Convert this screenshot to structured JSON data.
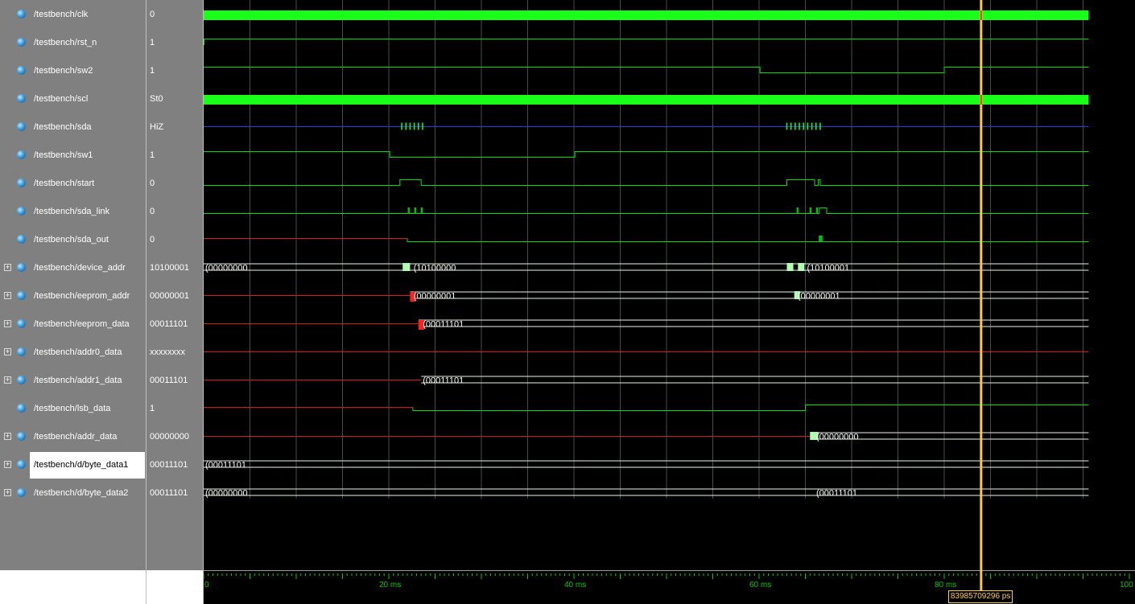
{
  "signals": [
    {
      "name": "/testbench/clk",
      "value": "0",
      "expandable": false
    },
    {
      "name": "/testbench/rst_n",
      "value": "1",
      "expandable": false
    },
    {
      "name": "/testbench/sw2",
      "value": "1",
      "expandable": false
    },
    {
      "name": "/testbench/scl",
      "value": "St0",
      "expandable": false
    },
    {
      "name": "/testbench/sda",
      "value": "HiZ",
      "expandable": false
    },
    {
      "name": "/testbench/sw1",
      "value": "1",
      "expandable": false
    },
    {
      "name": "/testbench/start",
      "value": "0",
      "expandable": false
    },
    {
      "name": "/testbench/sda_link",
      "value": "0",
      "expandable": false
    },
    {
      "name": "/testbench/sda_out",
      "value": "0",
      "expandable": false
    },
    {
      "name": "/testbench/device_addr",
      "value": "10100001",
      "expandable": true
    },
    {
      "name": "/testbench/eeprom_addr",
      "value": "00000001",
      "expandable": true
    },
    {
      "name": "/testbench/eeprom_data",
      "value": "00011101",
      "expandable": true
    },
    {
      "name": "/testbench/addr0_data",
      "value": "xxxxxxxx",
      "expandable": true
    },
    {
      "name": "/testbench/addr1_data",
      "value": "00011101",
      "expandable": true
    },
    {
      "name": "/testbench/lsb_data",
      "value": "1",
      "expandable": false
    },
    {
      "name": "/testbench/addr_data",
      "value": "00000000",
      "expandable": true
    },
    {
      "name": "/testbench/d/byte_data1",
      "value": "00011101",
      "expandable": true,
      "selected": true
    },
    {
      "name": "/testbench/d/byte_data2",
      "value": "00011101",
      "expandable": true
    }
  ],
  "bus_labels": [
    {
      "row": 9,
      "t": 0,
      "text": "00000000"
    },
    {
      "row": 9,
      "t": 22.5,
      "text": "10100000"
    },
    {
      "row": 9,
      "t": 65,
      "text": "10100001"
    },
    {
      "row": 10,
      "t": 22.5,
      "text": "00000001"
    },
    {
      "row": 10,
      "t": 64,
      "text": "00000001"
    },
    {
      "row": 11,
      "t": 23.5,
      "text": "00011101"
    },
    {
      "row": 13,
      "t": 23.5,
      "text": "00011101"
    },
    {
      "row": 15,
      "t": 66,
      "text": "00000000"
    },
    {
      "row": 16,
      "t": 0,
      "text": "00011101"
    },
    {
      "row": 17,
      "t": 0,
      "text": "00000000"
    },
    {
      "row": 17,
      "t": 66,
      "text": "00011101"
    }
  ],
  "timeline": {
    "ticks": [
      {
        "t": 0,
        "label": "0"
      },
      {
        "t": 20,
        "label": "20 ms"
      },
      {
        "t": 40,
        "label": "40 ms"
      },
      {
        "t": 60,
        "label": "60 ms"
      },
      {
        "t": 80,
        "label": "80 ms"
      },
      {
        "t": 100,
        "label": "100"
      }
    ],
    "end_t": 95.6
  },
  "cursor": {
    "t": 83.9857,
    "label": "83985709296 ps"
  },
  "colors": {
    "panel": "#808080",
    "wave_bg": "#000000",
    "signal": "#00e000",
    "bright": "#19ff19",
    "undefined": "#d02020",
    "bus": "#e8f5e8",
    "highz": "#2a3fd8",
    "cursor": "#ffc83c",
    "grid": "#4a4a4a",
    "timeline": "#00c800"
  }
}
